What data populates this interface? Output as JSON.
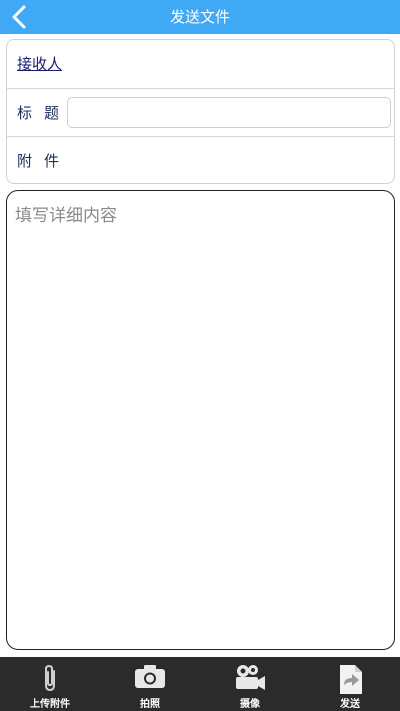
{
  "header": {
    "title": "发送文件",
    "back_icon": "chevron-left-icon",
    "color": "#3fa9f5"
  },
  "form": {
    "recipient_label": "接收人",
    "title_label": "标题",
    "title_value": "",
    "title_placeholder": "",
    "attachment_label": "附件"
  },
  "content": {
    "placeholder": "填写详细内容",
    "value": ""
  },
  "toolbar": {
    "items": [
      {
        "label": "上传附件",
        "icon": "paperclip-icon"
      },
      {
        "label": "拍照",
        "icon": "camera-icon"
      },
      {
        "label": "摄像",
        "icon": "video-camera-icon"
      },
      {
        "label": "发送",
        "icon": "send-icon"
      }
    ]
  }
}
